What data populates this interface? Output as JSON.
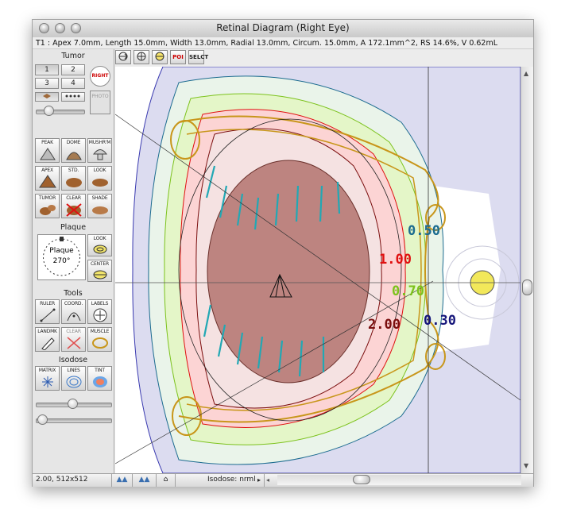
{
  "window": {
    "title": "Retinal Diagram (Right Eye)",
    "info": "T1 : Apex 7.0mm, Length 15.0mm, Width 13.0mm, Radial 13.0mm, Circum. 15.0mm, A 172.1mm^2, RS 14.6%, V 0.62mL"
  },
  "toolbar": {
    "poi_label": "POI",
    "select_label": "SELCT"
  },
  "sidebar": {
    "tumor_title": "Tumor",
    "tumor_buttons": [
      "1",
      "2",
      "3",
      "4"
    ],
    "right_badge": "RIGHT",
    "photo_label": "PHOTO",
    "shape_buttons": [
      "PEAK",
      "DOME",
      "MUSHR'M",
      "APEX",
      "STD.",
      "LOOK",
      "TUMOR",
      "CLEAR",
      "SHADE"
    ],
    "plaque_title": "Plaque",
    "plaque_dial_label": "Plaque",
    "plaque_angle": "270°",
    "plaque_buttons": [
      "LOOK",
      "CENTER"
    ],
    "tools_title": "Tools",
    "tool_buttons": [
      "RULER",
      "COORD.",
      "LABELS",
      "LANDMK",
      "CLEAR",
      "MUSCLE"
    ],
    "isodose_title": "Isodose",
    "isodose_buttons": [
      "MATRIX",
      "LINES",
      "TINT"
    ]
  },
  "diagram": {
    "isodose_labels": [
      {
        "text": "0.50",
        "color": "#1b6b8f"
      },
      {
        "text": "1.00",
        "color": "#e01010"
      },
      {
        "text": "0.70",
        "color": "#7cc21c"
      },
      {
        "text": "2.00",
        "color": "#7a0e0e"
      },
      {
        "text": "0.30",
        "color": "#15157a"
      }
    ]
  },
  "status": {
    "zoom": "2.00, 512x512",
    "isodose": "Isodose: nrml"
  },
  "colors": {
    "titlebar": "#d6d6d6",
    "sidebar": "#e6e6e6",
    "tumor": "#a8605a",
    "outer_field": "#dcdcf0"
  }
}
